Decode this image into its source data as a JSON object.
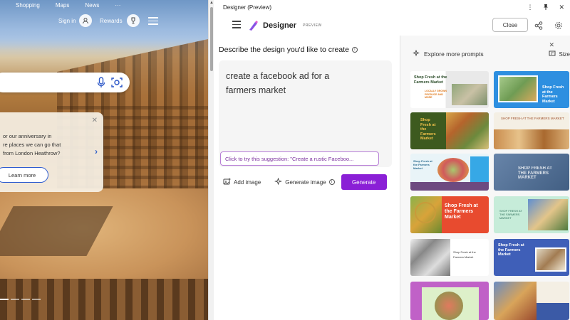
{
  "bing": {
    "top_nav": [
      "Shopping",
      "Maps",
      "News",
      "···"
    ],
    "sign_in": "Sign in",
    "rewards": "Rewards",
    "promo": {
      "lines": [
        "or our anniversary in",
        "re places we can go that",
        "from London Heathrow?"
      ],
      "cta": "Learn more"
    }
  },
  "designer": {
    "window_title": "Designer (Preview)",
    "app_name": "Designer",
    "preview_tag": "PREVIEW",
    "close_label": "Close",
    "heading": "Describe the design you'd like to create",
    "prompt_lines": [
      "create a facebook ad for a",
      "farmers market"
    ],
    "suggestion": "Click to try this suggestion: \"Create a rustic Faceboo...",
    "add_image": "Add image",
    "generate_image": "Generate image",
    "generate_button": "Generate",
    "explore": "Explore more prompts",
    "size": "Size",
    "templates": [
      {
        "caption": "Shop Fresh at the Farmers Market",
        "sub": "LOCALLY GROWN PRODUCE AND MORE"
      },
      {
        "caption": "Shop Fresh at the Farmers Market",
        "sub": ""
      },
      {
        "caption": "Shop Fresh at the Farmers Market",
        "sub": ""
      },
      {
        "caption": "SHOP FRESH AT THE FARMERS MARKET",
        "sub": ""
      },
      {
        "caption": "Shop Fresh at the Farmers Market",
        "sub": ""
      },
      {
        "caption": "SHOP FRESH AT THE FARMERS MARKET",
        "sub": ""
      },
      {
        "caption": "Shop Fresh at the Farmers Market",
        "sub": ""
      },
      {
        "caption": "SHOP FRESH AT THE FARMERS MARKET",
        "sub": ""
      },
      {
        "caption": "Shop Fresh at the Farmers Market",
        "sub": ""
      },
      {
        "caption": "Shop Fresh at the Farmers Market",
        "sub": ""
      },
      {
        "caption": "",
        "sub": ""
      },
      {
        "caption": "",
        "sub": ""
      }
    ],
    "colors": {
      "accent": "#8a1fd6",
      "suggestion_border": "#b77fd6",
      "suggestion_text": "#7a2f9d"
    }
  }
}
